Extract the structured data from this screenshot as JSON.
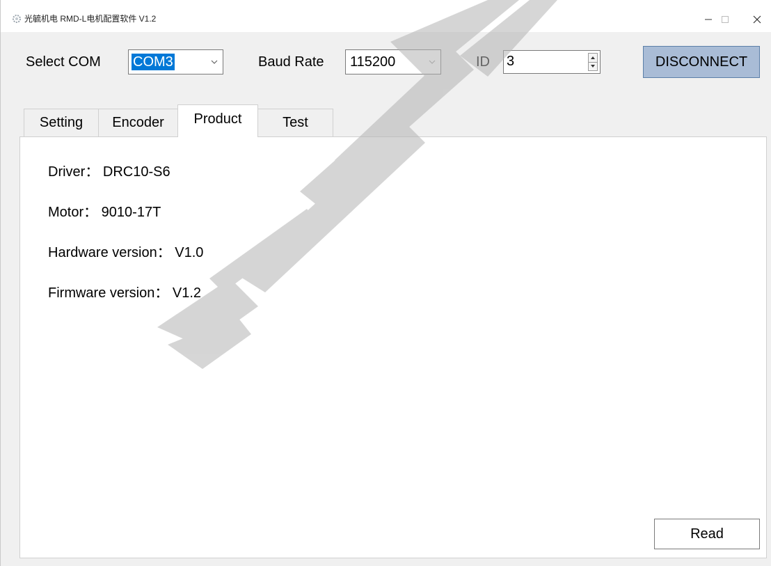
{
  "window": {
    "title": "光毓机电 RMD-L电机配置软件 V1.2",
    "controls": {
      "minimize": "—",
      "maximize": "☐",
      "close": "✕"
    }
  },
  "toolbar": {
    "select_com_label": "Select COM",
    "com_value": "COM3",
    "baud_rate_label": "Baud Rate",
    "baud_rate_value": "115200",
    "id_label": "ID",
    "id_value": "3",
    "disconnect_label": "DISCONNECT"
  },
  "tabs": [
    {
      "label": "Setting",
      "active": false
    },
    {
      "label": "Encoder",
      "active": false
    },
    {
      "label": "Product",
      "active": true
    },
    {
      "label": "Test",
      "active": false
    }
  ],
  "product": {
    "driver": "Driver：  DRC10-S6",
    "motor": "Motor：  9010-17T",
    "hardware": "Hardware version：  V1.0",
    "firmware": "Firmware version：  V1.2",
    "read_label": "Read"
  },
  "colors": {
    "disconnect_bg": "#a9bcd6",
    "selection": "#0078d7",
    "watermark": "#bdbdbd"
  }
}
